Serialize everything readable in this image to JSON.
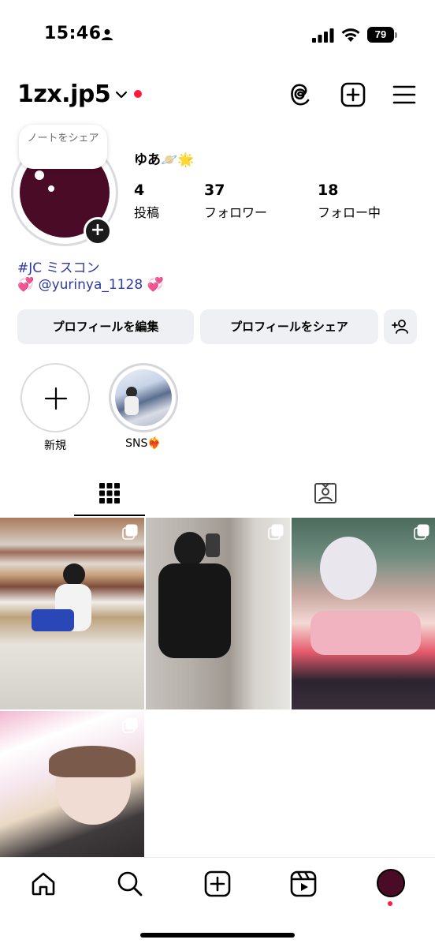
{
  "status_bar": {
    "time": "15:46",
    "battery": "79"
  },
  "header": {
    "username": "1zx.jp5"
  },
  "profile": {
    "note": "ノートをシェア",
    "display_name": "ゆあ🪐🌟",
    "stats": [
      {
        "num": "4",
        "label": "投稿"
      },
      {
        "num": "37",
        "label": "フォロワー"
      },
      {
        "num": "18",
        "label": "フォロー中"
      }
    ],
    "bio": [
      "#JC ミスコン",
      "💞 @yurinya_1128 💞"
    ]
  },
  "actions": {
    "edit": "プロフィールを編集",
    "share": "プロフィールをシェア"
  },
  "highlights": [
    {
      "label": "新規"
    },
    {
      "label": "SNS❤️‍🔥"
    }
  ],
  "colors": {
    "avatar": "#4a0b26",
    "bio_link": "#2e3aa0",
    "notification_dot": "#ff1a3c",
    "button_bg": "#eff0f3"
  },
  "icons": {
    "header": [
      "threads-icon",
      "plus-box-icon",
      "menu-icon"
    ],
    "tabs": [
      "grid-icon",
      "tagged-icon"
    ],
    "bottom_nav": [
      "home-icon",
      "search-icon",
      "create-icon",
      "reels-icon",
      "profile-avatar"
    ]
  }
}
